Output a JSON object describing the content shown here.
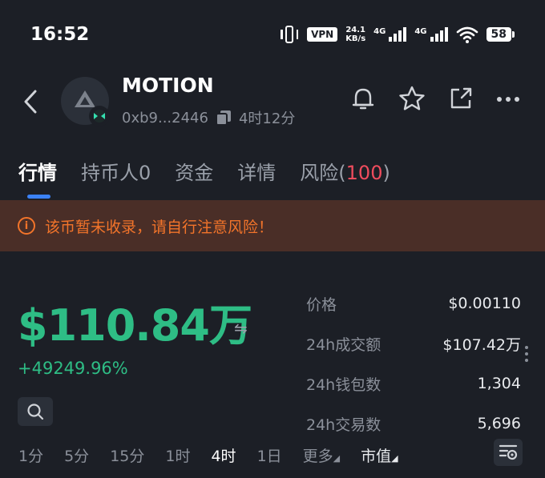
{
  "status_bar": {
    "time": "16:52",
    "vpn": "VPN",
    "speed_value": "24.1",
    "speed_unit": "KB/s",
    "net1": "4G",
    "net2": "4G",
    "battery": "58"
  },
  "header": {
    "token_name": "MOTION",
    "address": "0xb9...2446",
    "age": "4时12分"
  },
  "tabs": [
    {
      "label": "行情"
    },
    {
      "label": "持币人0"
    },
    {
      "label": "资金"
    },
    {
      "label": "详情"
    },
    {
      "label_prefix": "风险(",
      "risk_value": "100",
      "label_suffix": ")"
    }
  ],
  "warning": {
    "icon_text": "i",
    "text": "该币暂未收录，请自行注意风险！"
  },
  "main": {
    "market_cap": "$110.84万",
    "swap_icon": "⇋",
    "change": "+49249.96%"
  },
  "stats": [
    {
      "label": "价格",
      "value": "$0.00110"
    },
    {
      "label": "24h成交额",
      "value": "$107.42万"
    },
    {
      "label": "24h钱包数",
      "value": "1,304"
    },
    {
      "label": "24h交易数",
      "value": "5,696"
    }
  ],
  "timeframes": {
    "items": [
      "1分",
      "5分",
      "15分",
      "1时",
      "4时",
      "1日"
    ],
    "active": "4时",
    "more": "更多",
    "metric": "市值"
  },
  "colors": {
    "background": "#1c1f26",
    "positive": "#2ebd85",
    "warning": "#f2742a",
    "risk": "#ef4c5d",
    "accent": "#3b82f6"
  }
}
